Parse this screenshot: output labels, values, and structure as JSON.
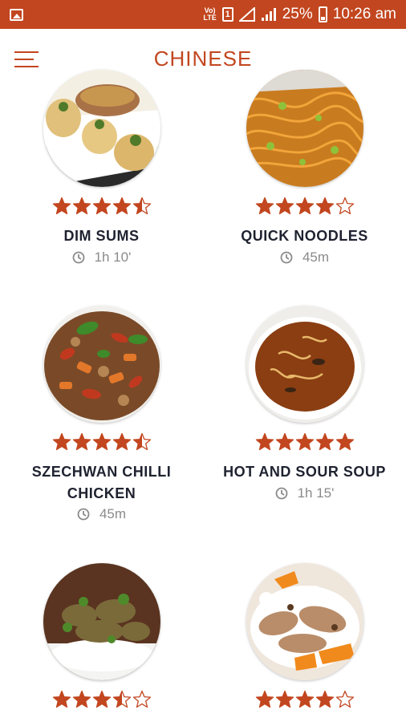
{
  "status_bar": {
    "volte": "Vo) LTE",
    "sim": "1",
    "battery": "25%",
    "time": "10:26 am",
    "icons": [
      "gallery-icon",
      "volte-icon",
      "sim-icon",
      "signal-icon",
      "battery-icon"
    ]
  },
  "app_bar": {
    "title": "CHINESE",
    "menu_icon": "hamburger-menu-icon"
  },
  "colors": {
    "accent": "#c2461f",
    "star": "#c2461f",
    "text": "#1f2330",
    "muted": "#8a8a8a"
  },
  "recipes": [
    {
      "name": "DIM SUMS",
      "rating": 4.5,
      "time": "1h 10'"
    },
    {
      "name": "QUICK NOODLES",
      "rating": 4,
      "time": "45m"
    },
    {
      "name": "SZECHWAN CHILLI CHICKEN",
      "rating": 4.5,
      "time": "45m"
    },
    {
      "name": "HOT AND SOUR SOUP",
      "rating": 5,
      "time": "1h 15'"
    },
    {
      "name": "",
      "rating": 3.5,
      "time": ""
    },
    {
      "name": "",
      "rating": 4,
      "time": ""
    }
  ]
}
